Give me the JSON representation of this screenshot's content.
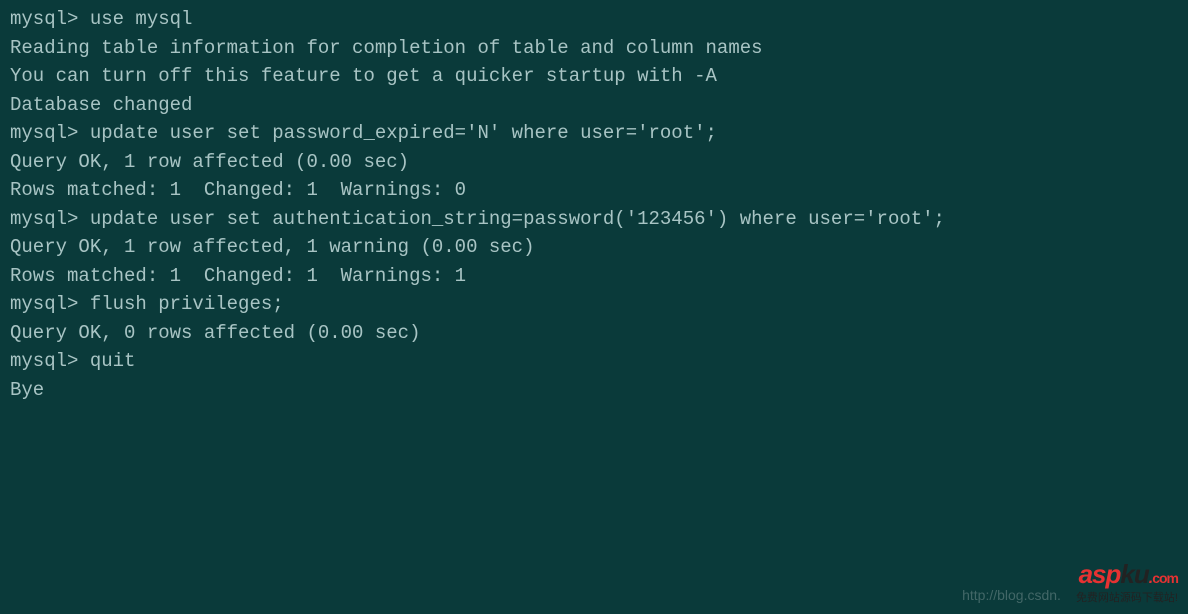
{
  "terminal": {
    "lines": [
      "mysql> use mysql",
      "Reading table information for completion of table and column names",
      "You can turn off this feature to get a quicker startup with -A",
      "",
      "Database changed",
      "mysql> update user set password_expired='N' where user='root';",
      "Query OK, 1 row affected (0.00 sec)",
      "Rows matched: 1  Changed: 1  Warnings: 0",
      "",
      "mysql> update user set authentication_string=password('123456') where user='root';",
      "Query OK, 1 row affected, 1 warning (0.00 sec)",
      "Rows matched: 1  Changed: 1  Warnings: 1",
      "",
      "mysql> flush privileges;",
      "Query OK, 0 rows affected (0.00 sec)",
      "",
      "mysql> quit",
      "Bye"
    ]
  },
  "watermark": {
    "url": "http://blog.csdn.",
    "logo_a": "a",
    "logo_s": "s",
    "logo_p": "p",
    "logo_k": "k",
    "logo_u": "u",
    "logo_dot": ".",
    "logo_com": "com",
    "subtitle": "免费网站源码下载站!"
  }
}
